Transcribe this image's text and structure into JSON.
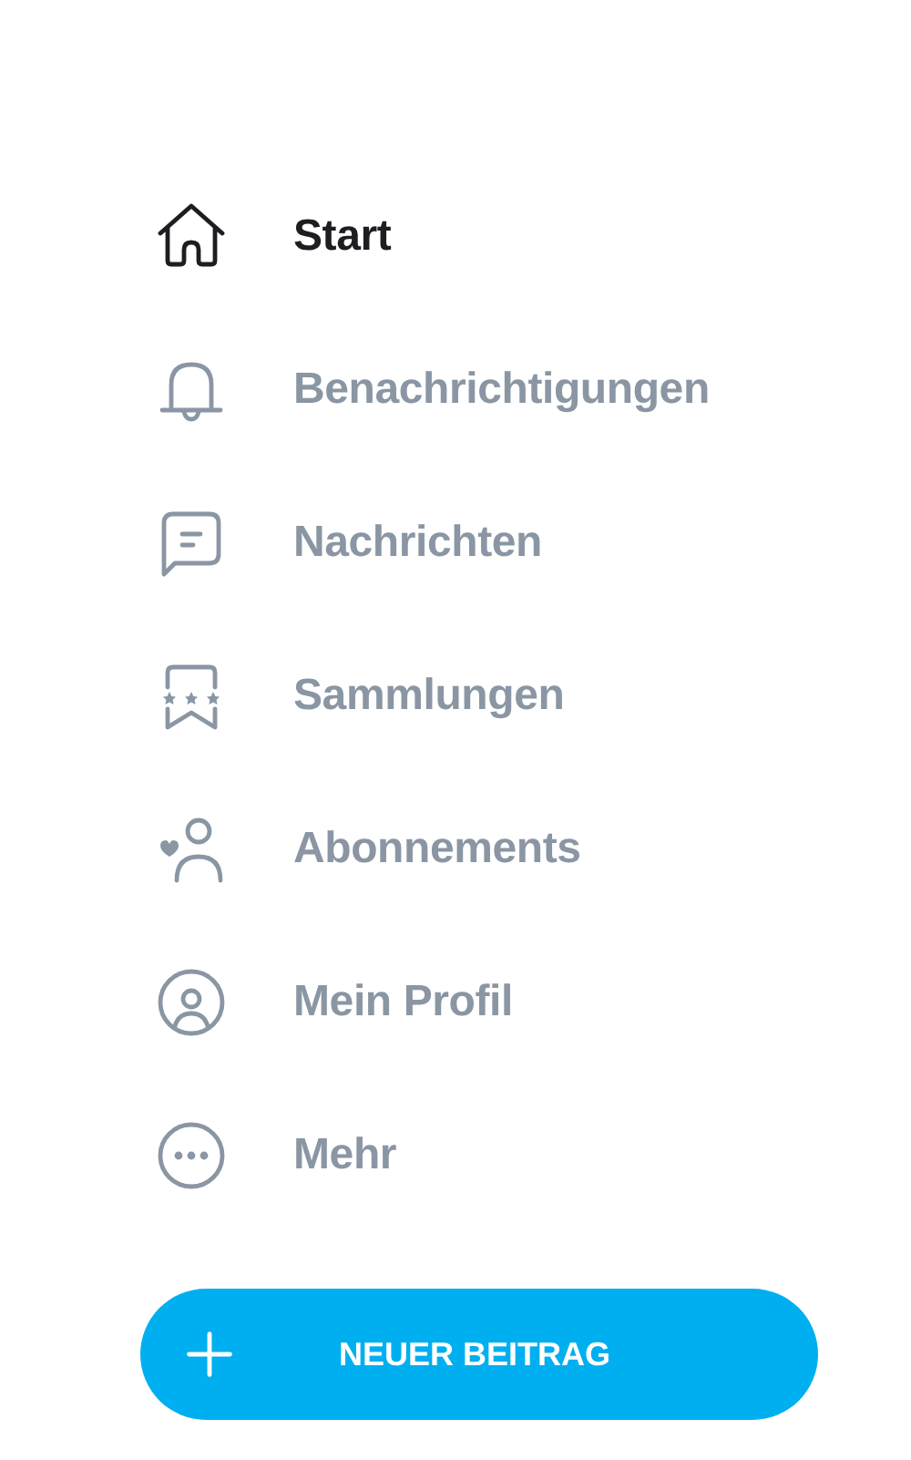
{
  "nav": [
    {
      "kind": "home",
      "label": "Start",
      "selected": true
    },
    {
      "kind": "bell",
      "label": "Benachrichtigungen",
      "selected": false
    },
    {
      "kind": "message",
      "label": "Nachrichten",
      "selected": false
    },
    {
      "kind": "collection",
      "label": "Sammlungen",
      "selected": false
    },
    {
      "kind": "subscriptions",
      "label": "Abonnements",
      "selected": false
    },
    {
      "kind": "profile",
      "label": "Mein Profil",
      "selected": false
    },
    {
      "kind": "more",
      "label": "Mehr",
      "selected": false
    }
  ],
  "new_post_button": {
    "label": "NEUER BEITRAG"
  }
}
